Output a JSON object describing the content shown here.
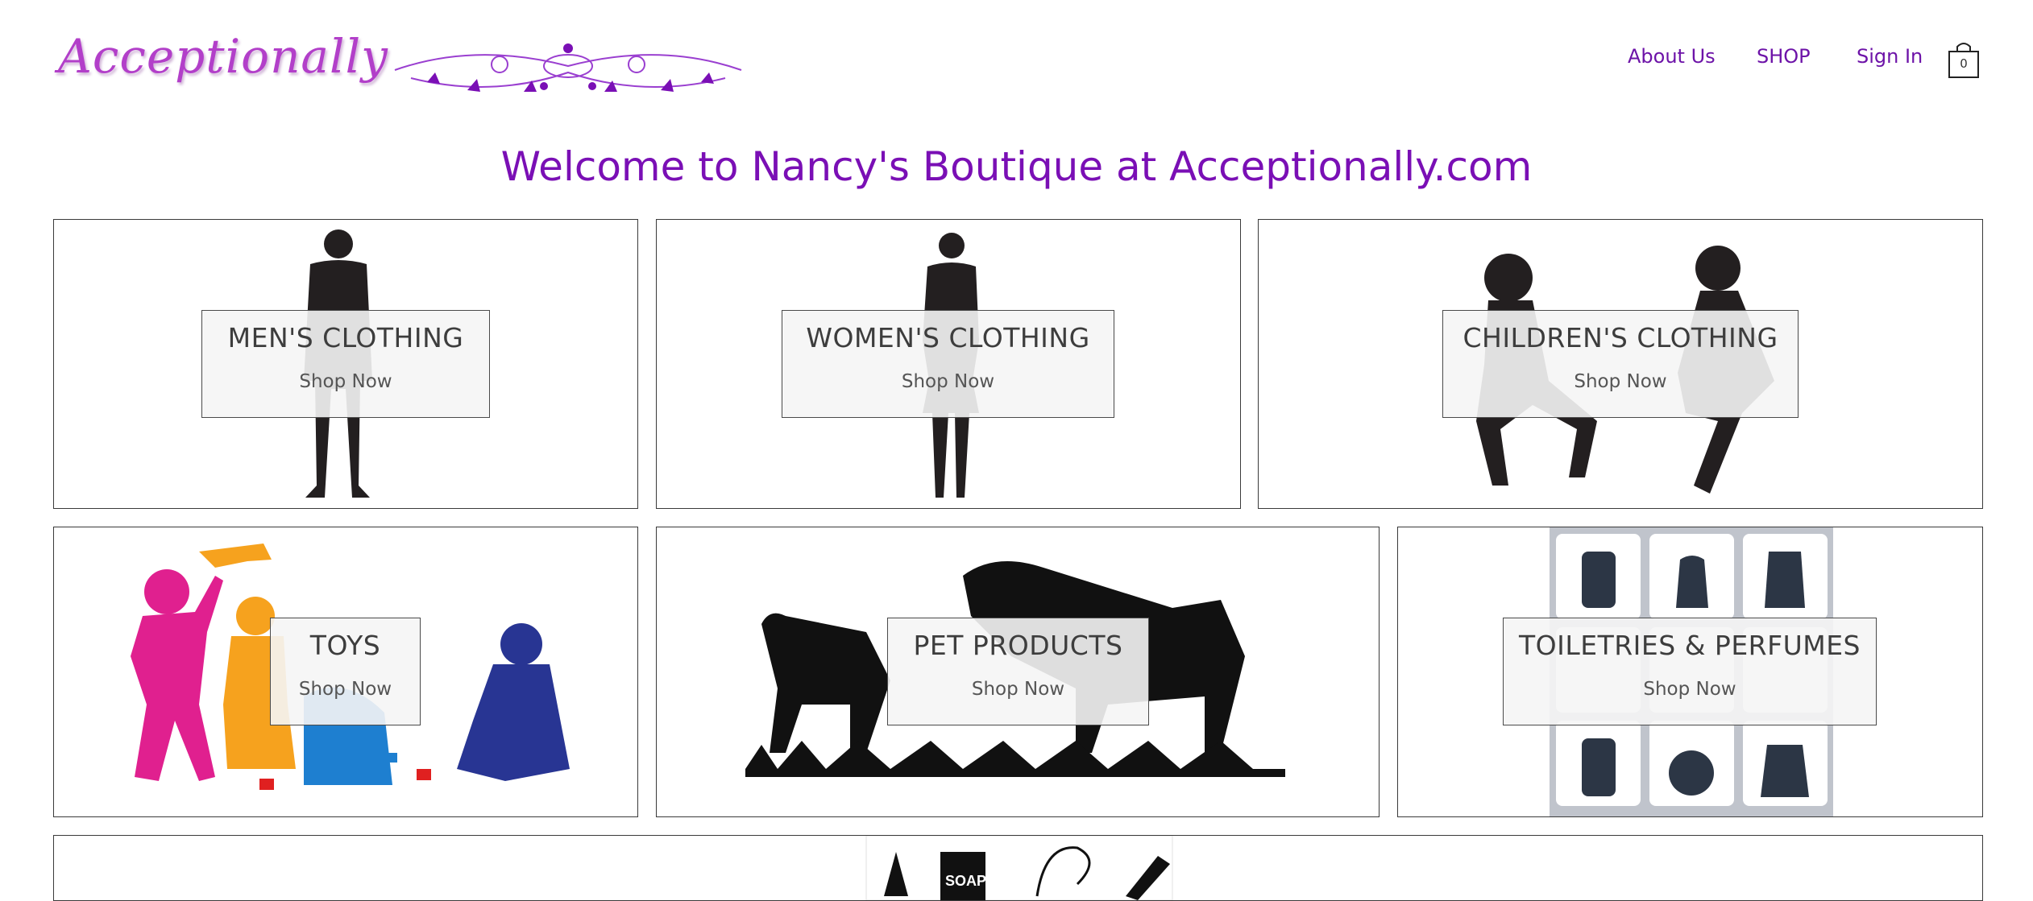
{
  "header": {
    "logo_text": "Acceptionally",
    "nav": [
      {
        "label": "About Us"
      },
      {
        "label": "SHOP"
      },
      {
        "label": "Sign In"
      }
    ],
    "cart_count": "0"
  },
  "welcome": "Welcome to Nancy's Boutique at Acceptionally.com",
  "categories": [
    {
      "title": "MEN'S CLOTHING",
      "link": "Shop Now"
    },
    {
      "title": "WOMEN'S CLOTHING",
      "link": "Shop Now"
    },
    {
      "title": "CHILDREN'S CLOTHING",
      "link": "Shop Now"
    },
    {
      "title": "TOYS",
      "link": "Shop Now"
    },
    {
      "title": "PET PRODUCTS",
      "link": "Shop Now"
    },
    {
      "title": "TOILETRIES & PERFUMES",
      "link": "Shop Now"
    }
  ],
  "bottom_tile": {
    "soap_text": "SOAP"
  },
  "colors": {
    "brand_purple": "#7a0fb5",
    "logo_purple": "#b23fc9"
  }
}
